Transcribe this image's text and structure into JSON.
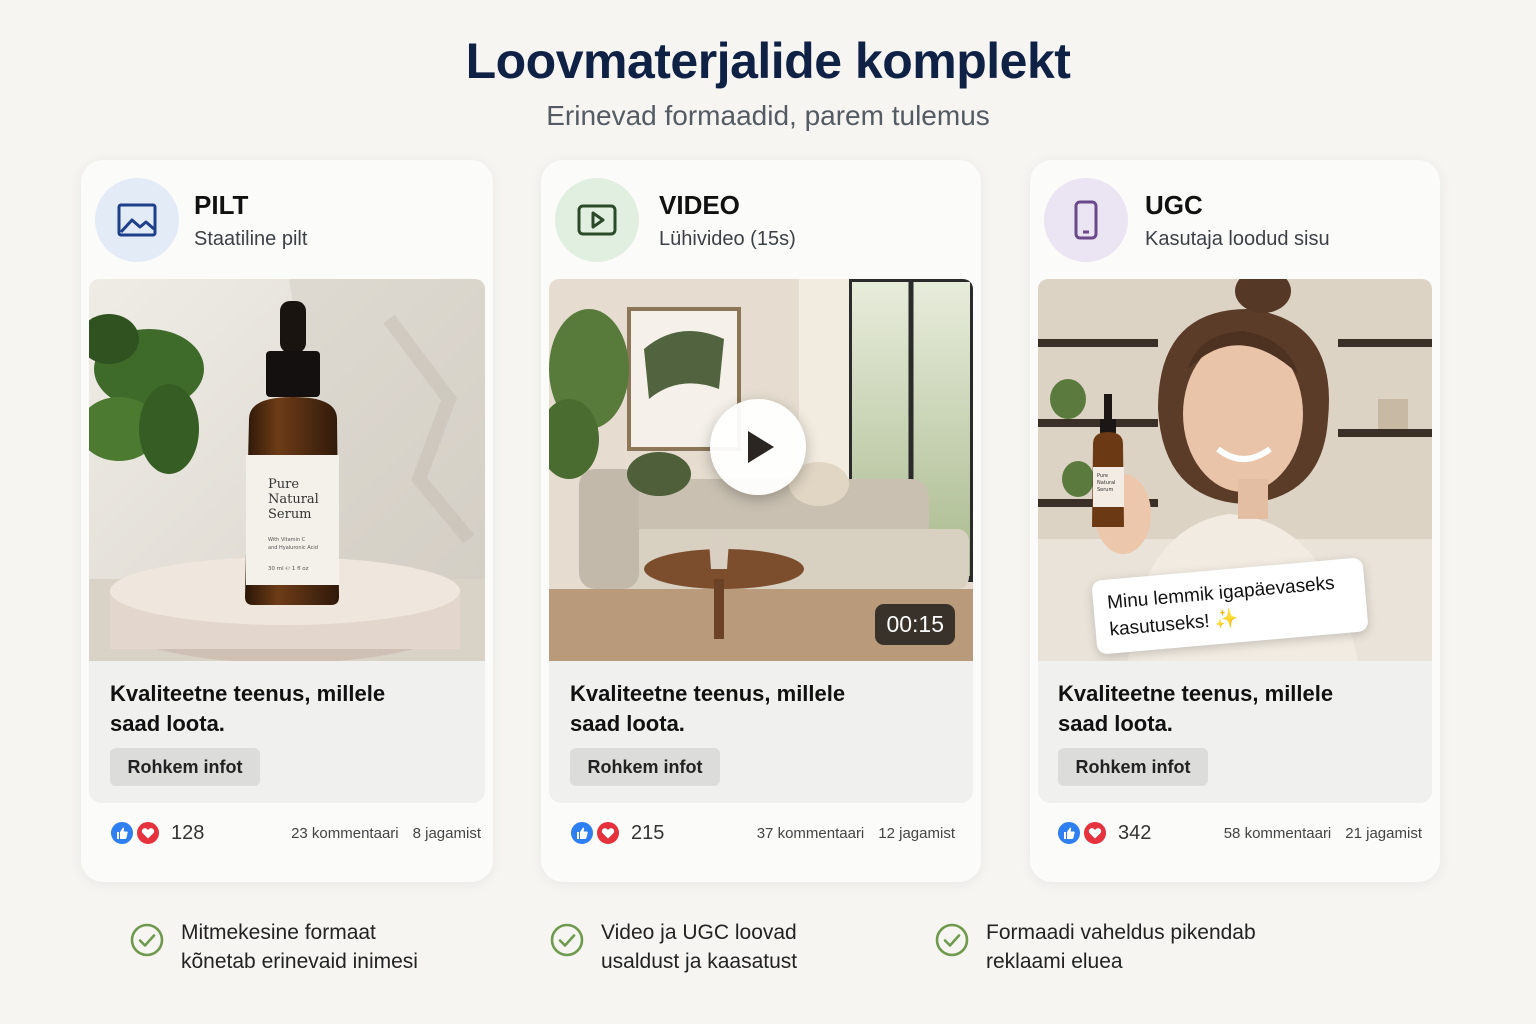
{
  "header": {
    "title": "Loovmaterjalide komplekt",
    "subtitle": "Erinevad formaadid, parem tulemus"
  },
  "cards": [
    {
      "format": "PILT",
      "description": "Staatiline pilt",
      "icon": "image-icon",
      "badge_color": "#e3ebf6",
      "icon_color": "#1e3f8a",
      "product_label": [
        "Pure",
        "Natural",
        "Serum"
      ],
      "product_fine_print": [
        "With Vitamin C",
        "and Hyaluronic Acid",
        "30 ml ℮ 1 fl oz"
      ],
      "headline": "Kvaliteetne teenus, millele saad loota.",
      "cta": "Rohkem infot",
      "reactions": "128",
      "comments": "23 kommentaari",
      "shares": "8 jagamist"
    },
    {
      "format": "VIDEO",
      "description": "Lühivideo (15s)",
      "icon": "play-square-icon",
      "badge_color": "#e1efe0",
      "icon_color": "#2a4a2a",
      "duration": "00:15",
      "headline": "Kvaliteetne teenus, millele saad loota.",
      "cta": "Rohkem infot",
      "reactions": "215",
      "comments": "37 kommentaari",
      "shares": "12 jagamist"
    },
    {
      "format": "UGC",
      "description": "Kasutaja loodud sisu",
      "icon": "smartphone-icon",
      "badge_color": "#ebe4f2",
      "icon_color": "#6a4a8a",
      "product_label": [
        "Pure",
        "Natural",
        "Serum"
      ],
      "quote": "Minu lemmik igapäevaseks kasutuseks! ✨",
      "headline": "Kvaliteetne teenus, millele saad loota.",
      "cta": "Rohkem infot",
      "reactions": "342",
      "comments": "58 kommentaari",
      "shares": "21 jagamist"
    }
  ],
  "benefits": [
    "Mitmekesine formaat kõnetab erinevaid inimesi",
    "Video ja UGC loovad usaldust ja kaasatust",
    "Formaadi vaheldus pikendab reklaami eluea"
  ],
  "colors": {
    "title": "#0f2246",
    "like": "#2d7ff2",
    "love": "#e5323d",
    "check": "#6f9a4e"
  }
}
